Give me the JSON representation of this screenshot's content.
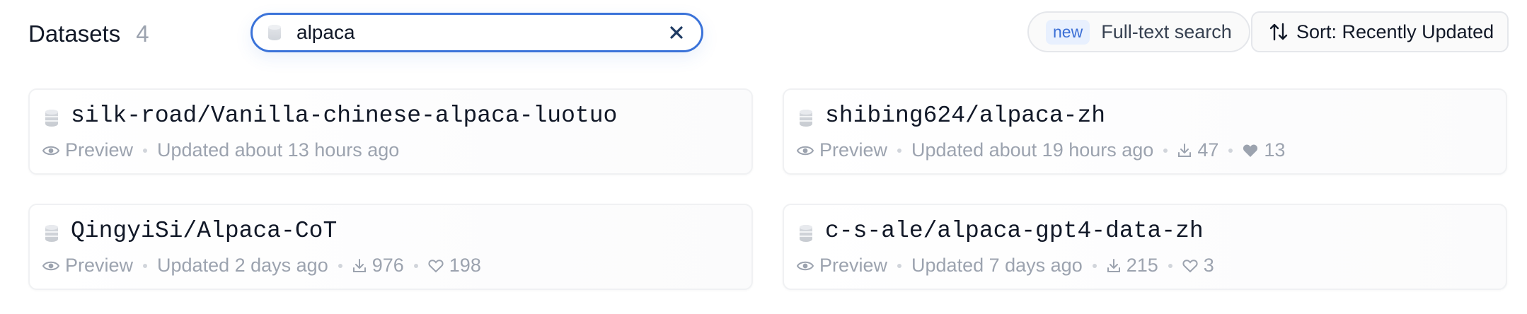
{
  "header": {
    "title": "Datasets",
    "count": "4",
    "search": {
      "value": "alpaca",
      "placeholder": ""
    },
    "full_text": {
      "badge": "new",
      "label": "Full-text search"
    },
    "sort": {
      "label": "Sort:  Recently Updated"
    }
  },
  "colors": {
    "accent": "#3b73d9",
    "muted": "#9ca3af",
    "badge_bg": "#e8f0fe"
  },
  "datasets": [
    {
      "name": "silk-road/Vanilla-chinese-alpaca-luotuo",
      "preview": "Preview",
      "updated": "Updated about 13 hours ago",
      "downloads": "",
      "likes": ""
    },
    {
      "name": "shibing624/alpaca-zh",
      "preview": "Preview",
      "updated": "Updated about 19 hours ago",
      "downloads": "47",
      "likes": "13"
    },
    {
      "name": "QingyiSi/Alpaca-CoT",
      "preview": "Preview",
      "updated": "Updated 2 days ago",
      "downloads": "976",
      "likes": "198"
    },
    {
      "name": "c-s-ale/alpaca-gpt4-data-zh",
      "preview": "Preview",
      "updated": "Updated 7 days ago",
      "downloads": "215",
      "likes": "3"
    }
  ],
  "icons": [
    "database-icon",
    "eye-icon",
    "download-icon",
    "heart-icon",
    "heart-filled-icon",
    "sort-arrows-icon",
    "close-icon"
  ]
}
